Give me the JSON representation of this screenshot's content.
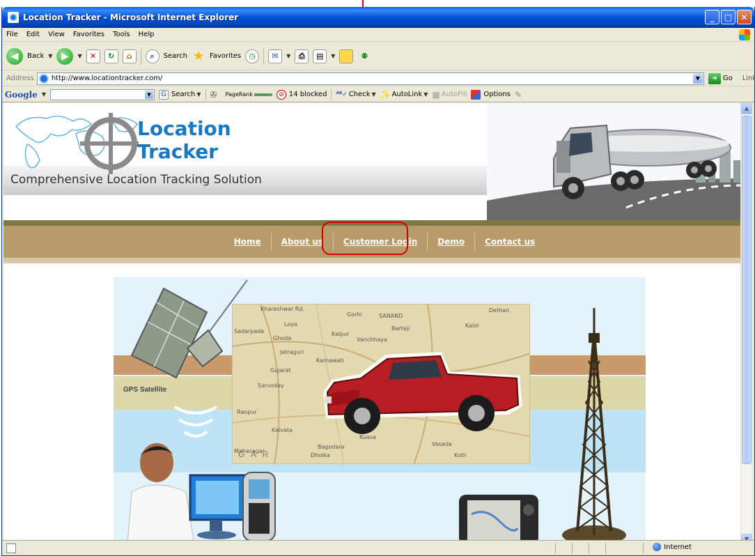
{
  "window": {
    "title": "Location Tracker - Microsoft Internet Explorer"
  },
  "menu": [
    "File",
    "Edit",
    "View",
    "Favorites",
    "Tools",
    "Help"
  ],
  "toolbar": {
    "back_label": "Back",
    "search_label": "Search",
    "favorites_label": "Favorites"
  },
  "address": {
    "label": "Address",
    "url": "http://www.locationtracker.com/",
    "go_label": "Go",
    "links_label": "Links"
  },
  "googlebar": {
    "logo": "Google",
    "search_label": "Search",
    "pagerank_label": "PageRank",
    "blocked_label": "14 blocked",
    "check_label": "Check",
    "autolink_label": "AutoLink",
    "autofill_label": "AutoFill",
    "options_label": "Options"
  },
  "site": {
    "logo_line1": "Location",
    "logo_line2": "Tracker",
    "tagline": "Comprehensive Location Tracking Solution",
    "nav": [
      "Home",
      "About us",
      "Customer Login",
      "Demo",
      "Contact us"
    ],
    "hero": {
      "gps_label": "GPS Satellite",
      "map_words": [
        "Khareshwar Rd.",
        "Gorhi",
        "SANAND",
        "Dethan",
        "Loya",
        "Kalol",
        "Sadarpada",
        "Ghoda",
        "Kalpur",
        "Barteji",
        "Vanchhaya",
        "Jatraguri",
        "Gujarat",
        "Karnawati",
        "Sarvoday",
        "Kalvata",
        "Bagodara",
        "Mahasagar",
        "Kuasa",
        "Vasada",
        "Ranpur",
        "Dholka",
        "Koth"
      ],
      "map_corner": "G A R"
    }
  },
  "status": {
    "zone_label": "Internet"
  },
  "colors": {
    "nav_bg": "#b99a6b",
    "logo_blue": "#1a78c2",
    "callout_red": "#d40000"
  }
}
